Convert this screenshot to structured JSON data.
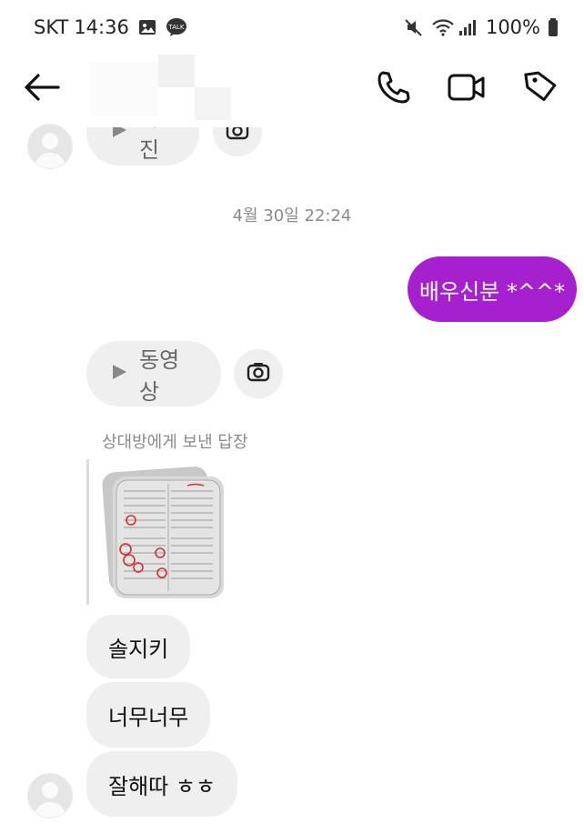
{
  "status_bar": {
    "carrier": "SKT",
    "time": "14:36",
    "battery": "100%",
    "icons": [
      "image-icon",
      "kakaotalk-icon",
      "mute-icon",
      "wifi-icon",
      "signal-icon",
      "battery-icon"
    ],
    "talk_badge": "TALK"
  },
  "header": {
    "actions": [
      "back-icon",
      "phone-icon",
      "video-icon",
      "tag-icon"
    ]
  },
  "messages": {
    "partial_top": {
      "label": "사진"
    },
    "timestamp": "4월 30일 22:24",
    "outgoing_1": "배우신분 *^^*",
    "video_pill": {
      "label": "동영상"
    },
    "reply_label": "상대방에게 보낸 답장",
    "incoming_1": "솔지키",
    "incoming_2": "너무너무",
    "incoming_3": "잘해따 ㅎㅎ"
  },
  "colors": {
    "accent": "#a620d0",
    "bubble_in": "#efefef",
    "muted_text": "#8a8a8a"
  }
}
